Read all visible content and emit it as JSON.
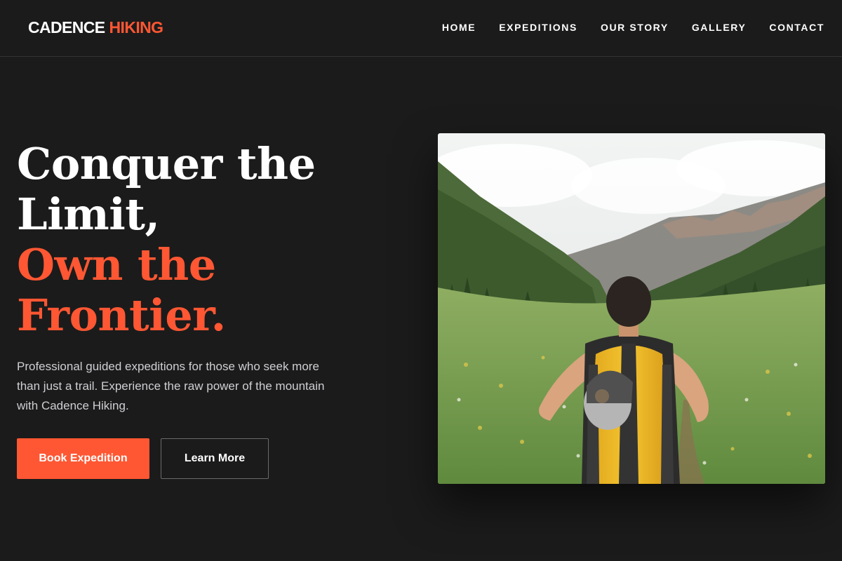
{
  "header": {
    "logo_word1": "CADENCE",
    "logo_word2": "HIKING",
    "nav": [
      "HOME",
      "EXPEDITIONS",
      "OUR STORY",
      "GALLERY",
      "CONTACT"
    ]
  },
  "hero": {
    "title_line1": "Conquer the",
    "title_line2": "Limit,",
    "title_line3": "Own the",
    "title_line4": "Frontier.",
    "description": "Professional guided expeditions for those who seek more than just a trail. Experience the raw power of the mountain with Cadence Hiking.",
    "primary_button": "Book Expedition",
    "secondary_button": "Learn More"
  },
  "colors": {
    "background": "#1b1b1b",
    "accent": "#ff5733",
    "text": "#ffffff",
    "muted_text": "#cfcfd4"
  },
  "icons": {
    "hero_image": "hiker-in-mountain-valley-photo"
  }
}
